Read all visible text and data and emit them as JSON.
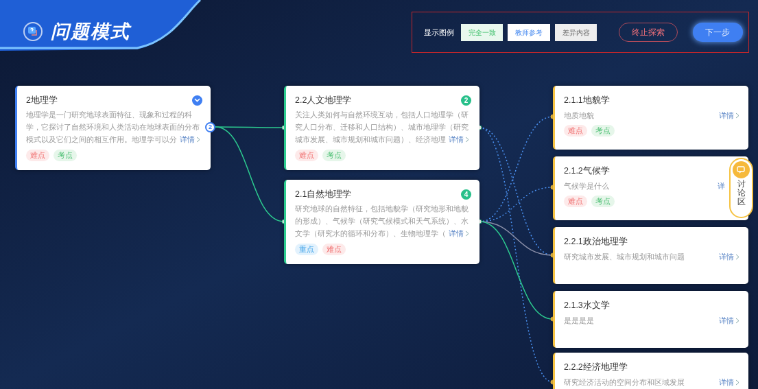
{
  "header": {
    "title": "问题模式"
  },
  "legend": {
    "label": "显示图例",
    "items": [
      {
        "label": "完全一致",
        "kind": "match"
      },
      {
        "label": "教师参考",
        "kind": "reference"
      },
      {
        "label": "差异内容",
        "kind": "difference"
      }
    ]
  },
  "actions": [
    {
      "label": "终止探索",
      "kind": "outline"
    },
    {
      "label": "下一步",
      "kind": "primary"
    }
  ],
  "root": {
    "title": "2地理学",
    "description": "地理学是一门研究地球表面特征、现象和过程的科学，它探讨了自然环境和人类活动在地球表面的分布模式以及它们之间的相互作用。地理学可以分",
    "details": "详情",
    "tags": [
      {
        "label": "难点",
        "kind": "difficult"
      },
      {
        "label": "考点",
        "kind": "exam"
      }
    ],
    "child_count": "2"
  },
  "middle": [
    {
      "title": "2.2人文地理学",
      "badge": "2",
      "description": "关注人类如何与自然环境互动，包括人口地理学（研究人口分布、迁移和人口结构）、城市地理学（研究城市发展、城市规划和城市问题）、经济地理",
      "details": "详情",
      "tags": [
        {
          "label": "难点",
          "kind": "difficult"
        },
        {
          "label": "考点",
          "kind": "exam"
        }
      ]
    },
    {
      "title": "2.1自然地理学",
      "badge": "4",
      "description": "研究地球的自然特征，包括地貌学（研究地形和地貌的形成）、气候学（研究气候模式和天气系统）、水文学（研究水的循环和分布）、生物地理学（",
      "details": "详情",
      "tags": [
        {
          "label": "重点",
          "kind": "key"
        },
        {
          "label": "难点",
          "kind": "difficult"
        }
      ]
    }
  ],
  "leaves": [
    {
      "title": "2.1.1地貌学",
      "description": "地质地貌",
      "details": "详情",
      "tags": [
        {
          "label": "难点",
          "kind": "difficult"
        },
        {
          "label": "考点",
          "kind": "exam"
        }
      ]
    },
    {
      "title": "2.1.2气候学",
      "description": "气候学是什么",
      "details": "详",
      "tags": [
        {
          "label": "难点",
          "kind": "difficult"
        },
        {
          "label": "考点",
          "kind": "exam"
        }
      ]
    },
    {
      "title": "2.2.1政治地理学",
      "description": "研究城市发展、城市规划和城市问题",
      "details": "详情"
    },
    {
      "title": "2.1.3水文学",
      "description": "是是是是",
      "details": "详情"
    },
    {
      "title": "2.2.2经济地理学",
      "description": "研究经济活动的空间分布和区域发展",
      "details": "详情"
    }
  ],
  "discussion": {
    "label": "讨论区"
  }
}
